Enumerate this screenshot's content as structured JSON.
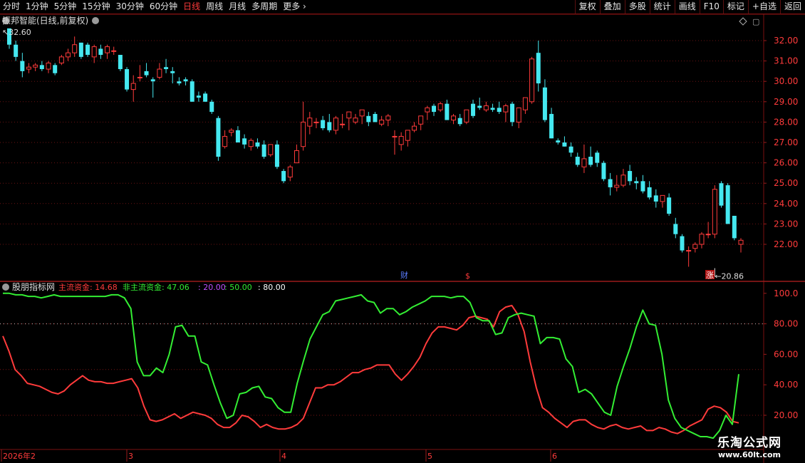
{
  "toolbar": {
    "periods": [
      "分时",
      "1分钟",
      "5分钟",
      "15分钟",
      "30分钟",
      "60分钟",
      "日线",
      "周线",
      "月线",
      "多周期",
      "更多"
    ],
    "active_period": "日线",
    "right_buttons": [
      "复权",
      "叠加",
      "多股",
      "统计",
      "画线",
      "F10",
      "标记",
      "+自选",
      "返回"
    ]
  },
  "price_panel": {
    "title": "振邦智能(日线,前复权)",
    "high_label": "32.60",
    "low_label": "20.86",
    "yticks": [
      "32.00",
      "31.00",
      "30.00",
      "29.00",
      "28.00",
      "27.00",
      "26.00",
      "25.00",
      "24.00",
      "23.00",
      "22.00"
    ],
    "event_markers": [
      "财",
      "$",
      "涨"
    ],
    "colors": {
      "up": "#ff3b3b",
      "down": "#45e8f0"
    }
  },
  "indicator_panel": {
    "name": "股朋指标网",
    "legend": [
      {
        "label": "主流资金: 14.68",
        "color": "#ff3b3b"
      },
      {
        "label": "非主流资金: 47.06",
        "color": "#33ee33"
      },
      {
        "label": ": 20.00",
        "color": "#c050ff"
      },
      {
        "label": ": 50.00",
        "color": "#33ee33"
      },
      {
        "label": ": 80.00",
        "color": "#ffffff"
      }
    ],
    "yticks": [
      "100.0",
      "80.00",
      "60.00",
      "40.00",
      "20.00"
    ]
  },
  "x_axis": {
    "labels": [
      "2026年2",
      "3",
      "4",
      "5",
      "6"
    ]
  },
  "watermark": {
    "title": "乐淘公式网",
    "url": "www.60lt.com"
  },
  "chart_data": [
    {
      "type": "candlestick",
      "title": "振邦智能(日线,前复权)",
      "ylim": [
        20.5,
        33.2
      ],
      "candles": [
        [
          32.6,
          32.6,
          31.6,
          31.8
        ],
        [
          31.8,
          32.0,
          31.0,
          31.2
        ],
        [
          31.0,
          31.4,
          30.2,
          30.5
        ],
        [
          30.6,
          30.9,
          30.4,
          30.7
        ],
        [
          30.7,
          30.9,
          30.5,
          30.8
        ],
        [
          30.8,
          31.0,
          30.5,
          30.6
        ],
        [
          30.6,
          31.0,
          30.4,
          30.9
        ],
        [
          30.8,
          30.9,
          30.3,
          30.4
        ],
        [
          30.9,
          31.3,
          30.8,
          31.2
        ],
        [
          31.2,
          31.6,
          31.0,
          31.4
        ],
        [
          31.4,
          32.2,
          31.2,
          31.8
        ],
        [
          31.9,
          31.9,
          31.1,
          31.2
        ],
        [
          31.8,
          31.9,
          31.2,
          31.3
        ],
        [
          31.2,
          31.8,
          30.9,
          31.7
        ],
        [
          31.6,
          31.8,
          31.1,
          31.3
        ],
        [
          31.4,
          31.8,
          31.1,
          31.7
        ],
        [
          31.5,
          31.7,
          31.3,
          31.5
        ],
        [
          31.3,
          31.3,
          30.5,
          30.6
        ],
        [
          30.6,
          30.7,
          29.5,
          29.6
        ],
        [
          29.6,
          30.3,
          29.0,
          29.9
        ],
        [
          30.2,
          30.8,
          30.0,
          30.2
        ],
        [
          30.5,
          30.9,
          30.2,
          30.3
        ],
        [
          30.1,
          30.2,
          29.2,
          30.0
        ],
        [
          30.2,
          30.9,
          30.1,
          30.6
        ],
        [
          30.7,
          31.1,
          30.4,
          30.6
        ],
        [
          30.5,
          30.7,
          29.9,
          30.4
        ],
        [
          30.0,
          30.2,
          29.8,
          29.9
        ],
        [
          30.1,
          30.2,
          29.8,
          30.0
        ],
        [
          30.0,
          30.1,
          29.0,
          29.0
        ],
        [
          29.3,
          29.5,
          29.0,
          29.2
        ],
        [
          29.4,
          29.5,
          29.0,
          29.0
        ],
        [
          29.0,
          29.1,
          28.4,
          28.5
        ],
        [
          28.2,
          28.3,
          26.1,
          26.3
        ],
        [
          26.8,
          27.6,
          26.7,
          27.3
        ],
        [
          27.5,
          27.7,
          27.3,
          27.6
        ],
        [
          27.6,
          27.8,
          27.0,
          27.0
        ],
        [
          27.2,
          27.4,
          26.7,
          26.9
        ],
        [
          26.8,
          27.2,
          26.6,
          27.1
        ],
        [
          27.0,
          27.2,
          26.7,
          26.8
        ],
        [
          26.9,
          27.1,
          26.2,
          26.3
        ],
        [
          26.4,
          26.7,
          26.3,
          26.9
        ],
        [
          26.9,
          27.1,
          25.7,
          25.8
        ],
        [
          25.6,
          25.7,
          25.0,
          25.1
        ],
        [
          25.3,
          25.9,
          25.1,
          25.8
        ],
        [
          26.0,
          26.9,
          26.0,
          26.6
        ],
        [
          26.8,
          29.0,
          26.6,
          28.0
        ],
        [
          27.8,
          28.5,
          27.4,
          28.2
        ],
        [
          28.0,
          28.2,
          27.7,
          28.0
        ],
        [
          28.1,
          28.3,
          27.6,
          27.7
        ],
        [
          28.0,
          28.4,
          27.5,
          27.6
        ],
        [
          27.6,
          28.3,
          27.4,
          28.2
        ],
        [
          27.9,
          28.4,
          27.7,
          27.9
        ],
        [
          28.2,
          28.5,
          27.6,
          28.5
        ],
        [
          28.0,
          28.4,
          27.9,
          28.2
        ],
        [
          28.3,
          28.6,
          27.9,
          28.6
        ],
        [
          28.3,
          28.5,
          27.8,
          28.0
        ],
        [
          28.4,
          28.5,
          28.0,
          28.0
        ],
        [
          27.9,
          28.3,
          27.8,
          28.1
        ],
        [
          28.1,
          28.4,
          27.8,
          28.3
        ],
        [
          27.3,
          27.6,
          26.4,
          27.3
        ],
        [
          26.9,
          27.5,
          26.6,
          27.3
        ],
        [
          27.1,
          27.5,
          26.8,
          27.6
        ],
        [
          27.6,
          28.0,
          27.5,
          27.8
        ],
        [
          27.9,
          28.3,
          27.6,
          28.3
        ],
        [
          28.5,
          28.8,
          28.1,
          28.7
        ],
        [
          28.8,
          28.9,
          28.3,
          28.5
        ],
        [
          28.6,
          29.0,
          28.5,
          28.9
        ],
        [
          28.9,
          29.1,
          28.1,
          28.1
        ],
        [
          28.1,
          28.4,
          27.9,
          28.3
        ],
        [
          28.2,
          28.4,
          27.8,
          27.9
        ],
        [
          28.0,
          28.6,
          27.9,
          28.6
        ],
        [
          28.9,
          29.1,
          28.2,
          28.3
        ],
        [
          28.8,
          29.2,
          28.6,
          28.7
        ],
        [
          28.6,
          29.0,
          28.5,
          28.8
        ],
        [
          28.7,
          28.9,
          28.5,
          28.6
        ],
        [
          28.7,
          29.0,
          28.4,
          28.5
        ],
        [
          28.5,
          28.9,
          28.0,
          28.8
        ],
        [
          28.9,
          29.0,
          27.8,
          28.0
        ],
        [
          28.0,
          28.6,
          27.7,
          28.7
        ],
        [
          28.6,
          29.1,
          28.4,
          29.2
        ],
        [
          29.0,
          31.2,
          28.9,
          31.1
        ],
        [
          31.4,
          32.0,
          29.5,
          29.9
        ],
        [
          29.7,
          30.1,
          28.0,
          28.1
        ],
        [
          28.4,
          28.7,
          27.2,
          27.2
        ],
        [
          27.1,
          27.2,
          26.9,
          27.0
        ],
        [
          27.0,
          27.3,
          26.8,
          26.8
        ],
        [
          26.8,
          27.0,
          26.3,
          26.5
        ],
        [
          26.3,
          26.5,
          25.8,
          25.9
        ],
        [
          25.8,
          26.9,
          25.5,
          26.2
        ],
        [
          26.3,
          26.8,
          25.8,
          25.9
        ],
        [
          26.5,
          26.6,
          25.8,
          26.0
        ],
        [
          26.0,
          26.1,
          25.1,
          25.2
        ],
        [
          25.2,
          25.5,
          24.4,
          24.8
        ],
        [
          24.8,
          25.4,
          24.6,
          24.9
        ],
        [
          24.9,
          25.7,
          24.8,
          25.4
        ],
        [
          25.6,
          25.9,
          24.9,
          25.1
        ],
        [
          25.1,
          25.3,
          24.7,
          25.0
        ],
        [
          25.1,
          25.4,
          24.5,
          24.6
        ],
        [
          24.8,
          25.1,
          24.2,
          24.3
        ],
        [
          24.4,
          24.7,
          23.8,
          24.1
        ],
        [
          24.1,
          24.4,
          23.8,
          24.4
        ],
        [
          24.3,
          24.5,
          23.4,
          23.5
        ],
        [
          23.0,
          23.3,
          22.3,
          22.5
        ],
        [
          22.4,
          22.5,
          21.6,
          21.7
        ],
        [
          21.7,
          21.9,
          20.9,
          21.7
        ],
        [
          21.8,
          22.1,
          21.6,
          22.0
        ],
        [
          22.0,
          22.6,
          21.8,
          22.5
        ],
        [
          22.5,
          23.1,
          22.3,
          22.5
        ],
        [
          22.5,
          24.9,
          22.3,
          24.7
        ],
        [
          25.0,
          25.1,
          23.8,
          23.9
        ],
        [
          24.9,
          25.0,
          23.0,
          23.0
        ],
        [
          23.4,
          23.4,
          22.2,
          22.3
        ],
        [
          22.0,
          22.3,
          21.6,
          22.2
        ]
      ]
    },
    {
      "type": "line",
      "title": "股朋指标网",
      "ylim": [
        0,
        105
      ],
      "reference_lines": [
        20,
        50,
        80
      ],
      "series": [
        {
          "name": "主流资金",
          "color": "#ff3b3b",
          "values": [
            72,
            62,
            50,
            46,
            41,
            40,
            39,
            37,
            35,
            34,
            36,
            40,
            43,
            46,
            43,
            42,
            42,
            41,
            41,
            42,
            43,
            44,
            38,
            26,
            17,
            16,
            17,
            19,
            21,
            18,
            20,
            22,
            21,
            20,
            18,
            14,
            12,
            12,
            15,
            20,
            19,
            16,
            12,
            14,
            12,
            11,
            11,
            12,
            14,
            18,
            28,
            38,
            38,
            40,
            40,
            42,
            45,
            48,
            48,
            50,
            51,
            53,
            53,
            53,
            47,
            43,
            47,
            52,
            58,
            67,
            74,
            78,
            78,
            77,
            76,
            79,
            84,
            85,
            84,
            83,
            78,
            88,
            91,
            92,
            86,
            75,
            55,
            38,
            25,
            22,
            18,
            15,
            12,
            16,
            17,
            17,
            14,
            12,
            11,
            13,
            14,
            12,
            11,
            12,
            13,
            10,
            10,
            12,
            11,
            9,
            8,
            10,
            13,
            15,
            17,
            24,
            26,
            25,
            22,
            16,
            15
          ]
        },
        {
          "name": "非主流资金",
          "color": "#33ee33",
          "values": [
            100,
            100,
            99,
            99,
            98,
            98,
            97,
            98,
            99,
            98,
            98,
            98,
            98,
            98,
            98,
            98,
            98,
            99,
            99,
            97,
            90,
            55,
            46,
            46,
            51,
            48,
            60,
            78,
            79,
            72,
            72,
            55,
            53,
            40,
            28,
            18,
            20,
            34,
            35,
            38,
            39,
            32,
            31,
            25,
            22,
            22,
            41,
            56,
            70,
            78,
            86,
            88,
            95,
            96,
            97,
            98,
            99,
            95,
            94,
            87,
            90,
            90,
            86,
            88,
            91,
            93,
            95,
            98,
            98,
            98,
            97,
            98,
            98,
            94,
            84,
            82,
            82,
            73,
            74,
            84,
            86,
            87,
            86,
            85,
            67,
            71,
            71,
            70,
            57,
            52,
            35,
            37,
            34,
            28,
            22,
            20,
            39,
            52,
            64,
            78,
            89,
            80,
            79,
            60,
            30,
            18,
            12,
            10,
            8,
            6,
            6,
            5,
            10,
            20,
            14,
            47
          ]
        }
      ]
    }
  ]
}
